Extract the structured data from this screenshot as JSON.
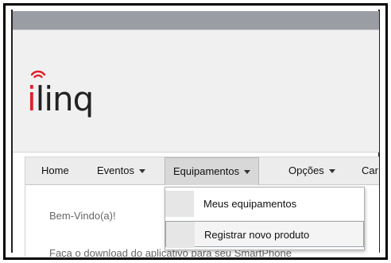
{
  "brand": {
    "logo_text_i": "i",
    "logo_text_rest": "linq",
    "accent_color": "#e0202b"
  },
  "nav": {
    "items": [
      {
        "label": "Home",
        "has_caret": false
      },
      {
        "label": "Eventos",
        "has_caret": true
      },
      {
        "label": "Equipamentos",
        "has_caret": true
      },
      {
        "label": "Opções",
        "has_caret": true
      },
      {
        "label": "Car",
        "has_caret": false
      }
    ]
  },
  "dropdown": {
    "items": [
      {
        "label": "Meus equipamentos"
      },
      {
        "label": "Registrar novo produto"
      }
    ]
  },
  "content": {
    "welcome": "Bem-Vindo(a)!",
    "download": "Faça o download do aplicativo para seu SmartPhone"
  }
}
